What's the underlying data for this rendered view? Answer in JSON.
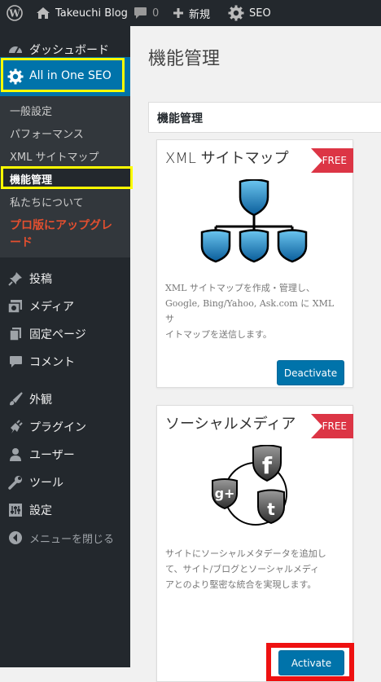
{
  "adminbar": {
    "site_name": "Takeuchi Blog",
    "comments_count": "0",
    "new_label": "新規",
    "seo_label": "SEO"
  },
  "sidebar": {
    "dashboard": "ダッシュボード",
    "aioseo": "All in One SEO",
    "submenu": [
      "一般設定",
      "パフォーマンス",
      "XML サイトマップ",
      "機能管理",
      "私たちについて"
    ],
    "upgrade_line1": "プロ版にアップグレ",
    "upgrade_line2": "ード",
    "items": [
      "投稿",
      "メディア",
      "固定ページ",
      "コメント",
      "外観",
      "プラグイン",
      "ユーザー",
      "ツール",
      "設定"
    ],
    "collapse": "メニューを閉じる"
  },
  "page": {
    "title": "機能管理",
    "panel_title": "機能管理"
  },
  "modules": [
    {
      "title": "XML サイトマップ",
      "badge": "FREE",
      "desc_lines": [
        "XML サイトマップを作成・管理し、",
        "Google, Bing/Yahoo, Ask.com に XML サ",
        "イトマップを送信します。"
      ],
      "button": "Deactivate",
      "icon": "sitemap-icon"
    },
    {
      "title": "ソーシャルメディア",
      "badge": "FREE",
      "desc_lines": [
        "サイトにソーシャルメタデータを追加し",
        "て、サイト/ブログとソーシャルメディ",
        "アとのより堅密な統合を実現します。"
      ],
      "button": "Activate",
      "icon": "social-media-icon"
    }
  ],
  "colors": {
    "admin_bg": "#23282d",
    "submenu_bg": "#32373c",
    "active_blue": "#0073aa",
    "highlight_yellow": "#ffff00",
    "highlight_red": "#ee1111",
    "upgrade_orange": "#e34f2f",
    "free_red": "#dc3545"
  }
}
